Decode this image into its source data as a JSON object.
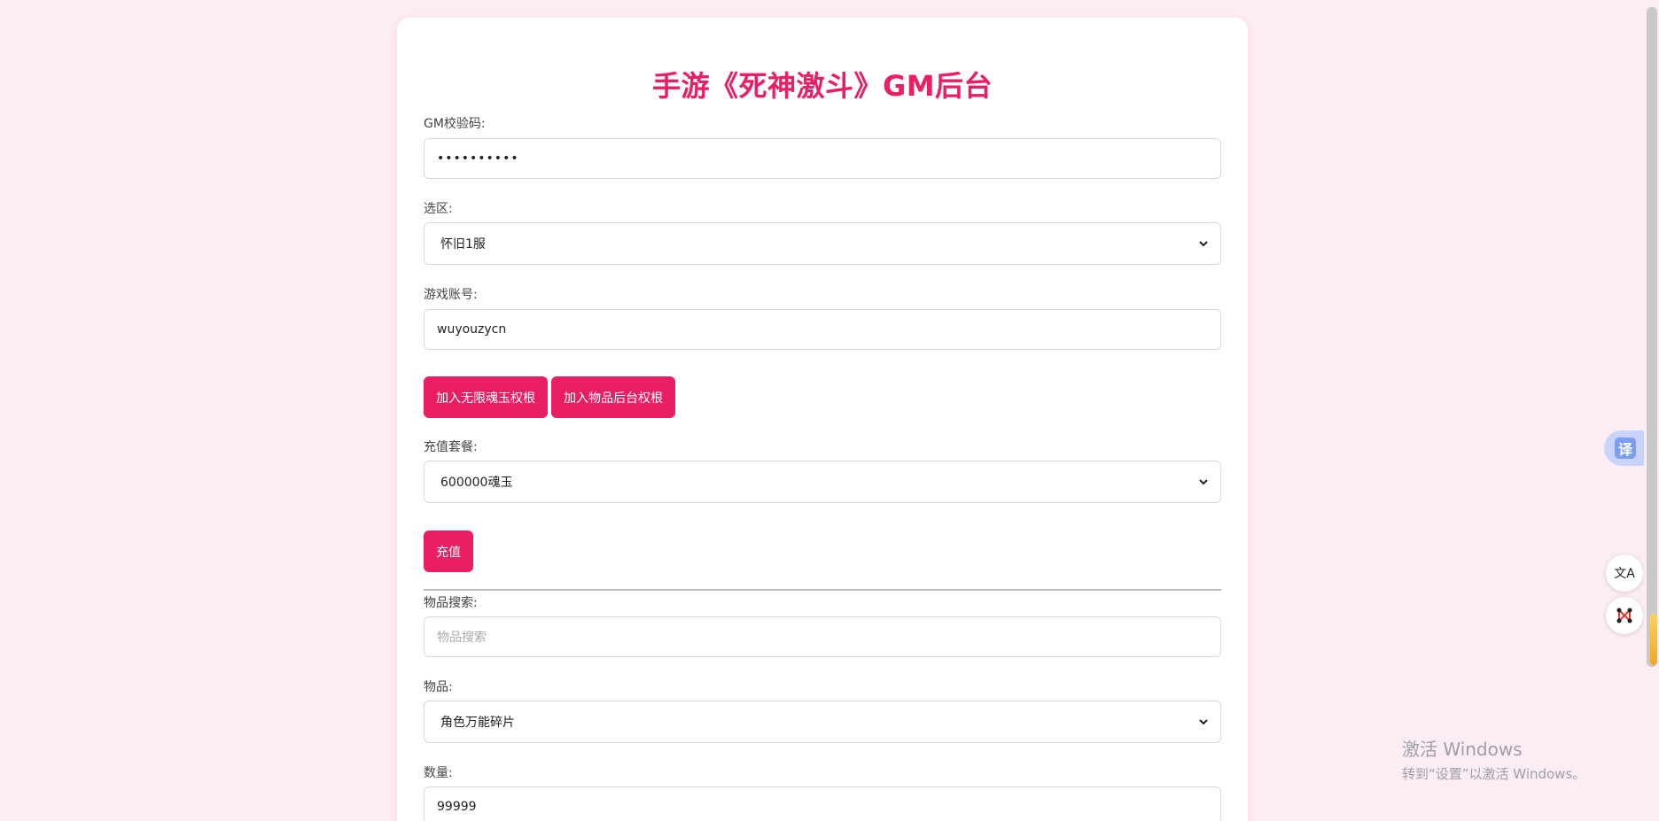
{
  "page": {
    "title": "手游《死神激斗》GM后台"
  },
  "form": {
    "gm_code": {
      "label": "GM校验码:",
      "value": "••••••••••"
    },
    "zone": {
      "label": "选区:",
      "value": "怀旧1服"
    },
    "account": {
      "label": "游戏账号:",
      "value": "wuyouzycn"
    },
    "buttons": {
      "add_soul": "加入无限魂玉权根",
      "add_item": "加入物品后台权根"
    },
    "recharge": {
      "label": "充值套餐:",
      "value": "600000魂玉",
      "button": "充值"
    },
    "item_search": {
      "label": "物品搜索:",
      "placeholder": "物品搜索"
    },
    "item": {
      "label": "物品:",
      "value": "角色万能碎片"
    },
    "quantity": {
      "label": "数量:",
      "value": "99999"
    }
  },
  "floating": {
    "translate_glyph": "译",
    "ai_translate_glyph": "文A"
  },
  "watermark": {
    "line1": "激活 Windows",
    "line2": "转到“设置”以激活 Windows。"
  },
  "colors": {
    "accent": "#e91e63",
    "background": "#fcedf4"
  }
}
